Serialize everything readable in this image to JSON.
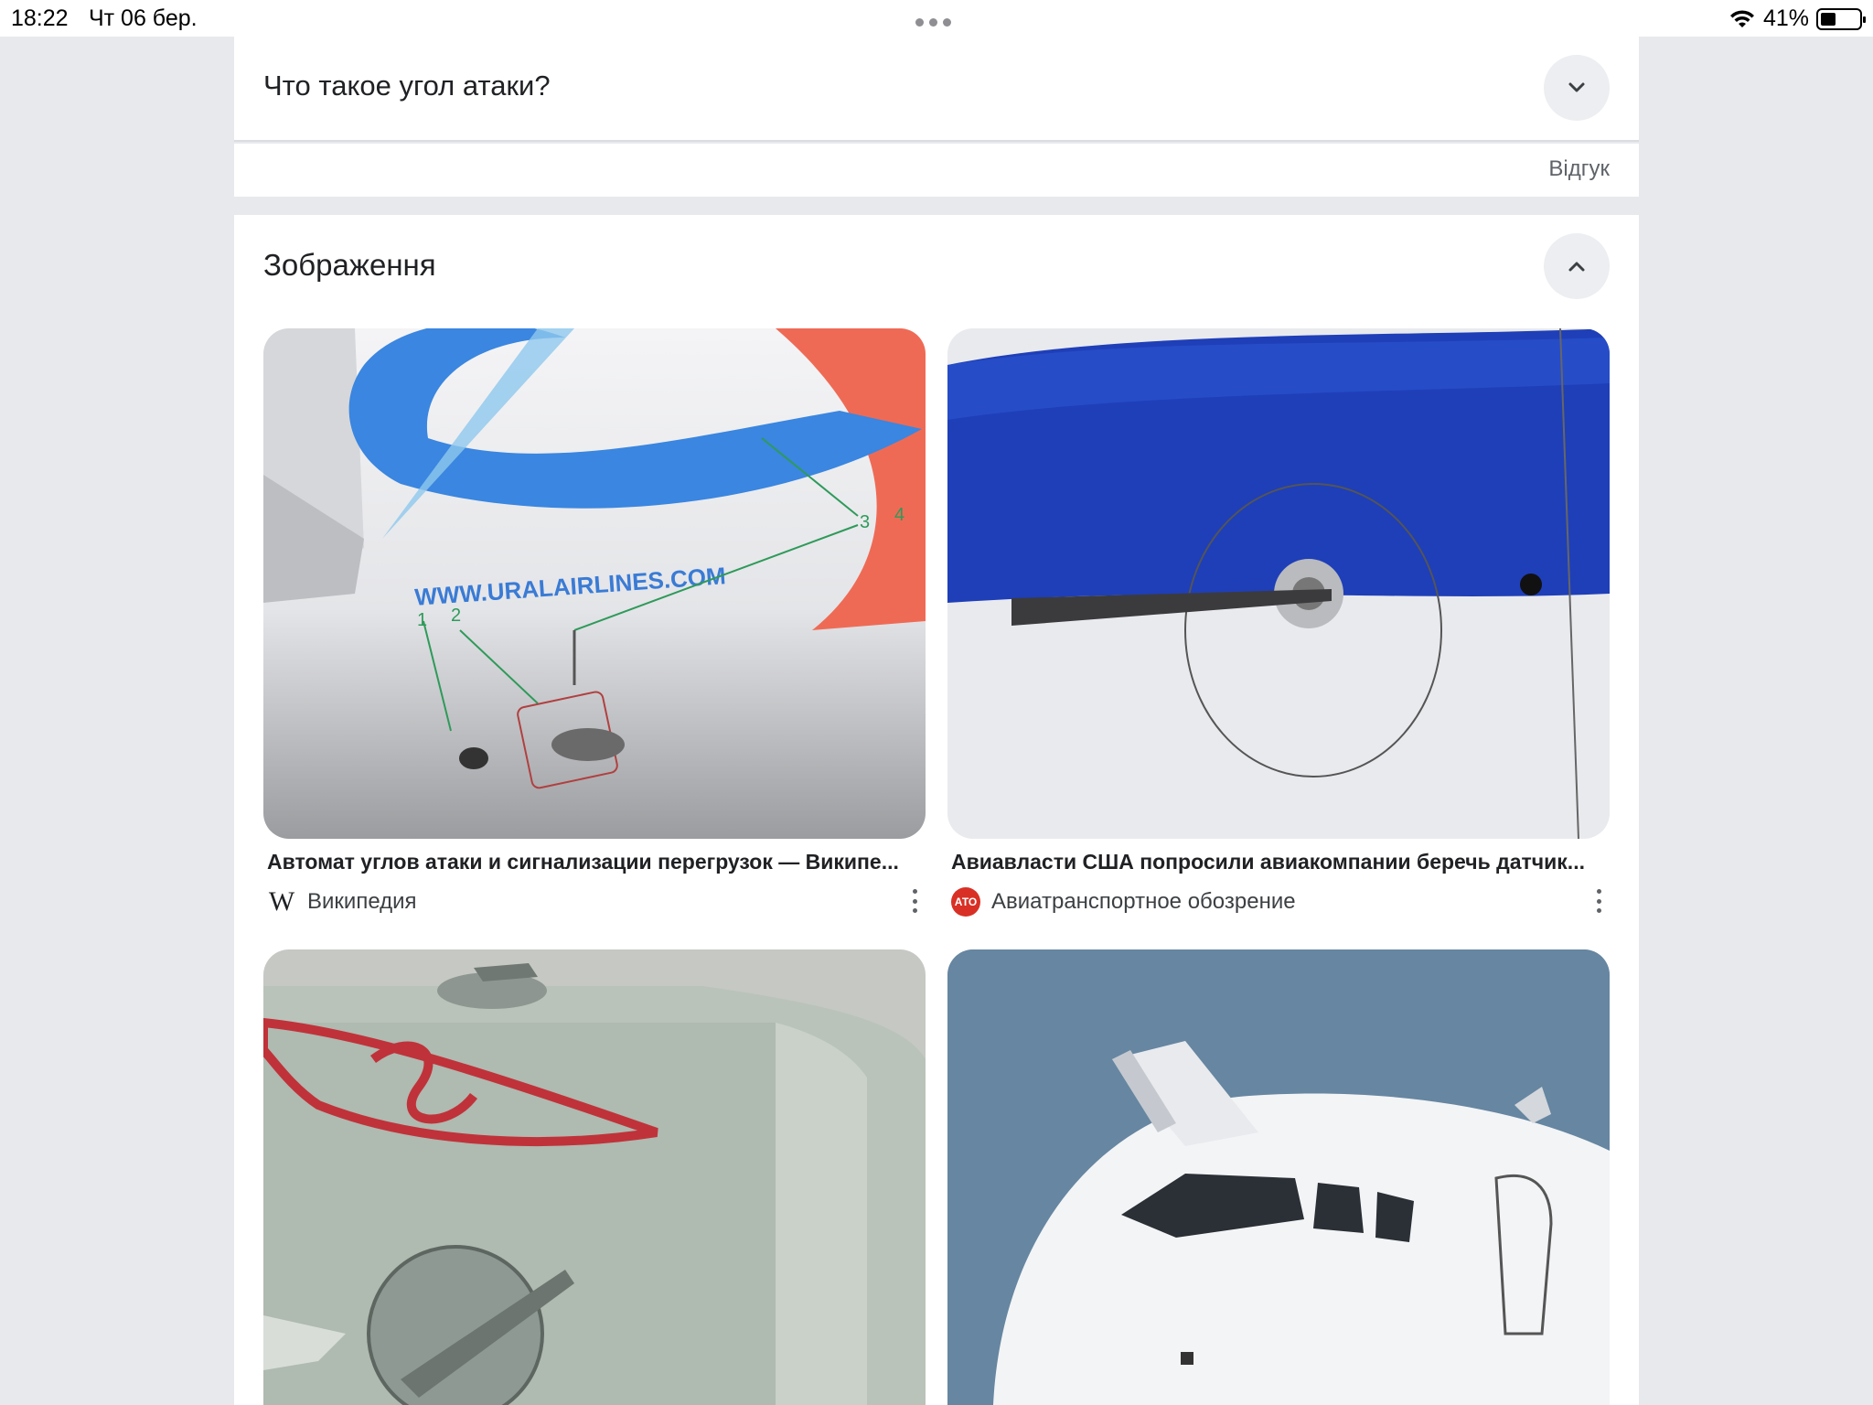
{
  "status_bar": {
    "time": "18:22",
    "date": "Чт 06 бер.",
    "battery": "41%",
    "battery_level": 0.41
  },
  "question_card": {
    "question": "Что такое угол атаки?",
    "expand_icon": "chevron-down-icon"
  },
  "feedback": {
    "label": "Відгук"
  },
  "images_section": {
    "title": "Зображення",
    "collapse_icon": "chevron-up-icon",
    "results": [
      {
        "caption": "Автомат углов атаки и сигнализации перегрузок — Википе...",
        "source": "Википедия",
        "logo": "W",
        "image_text": "WWW.URALAIRLINES.COM"
      },
      {
        "caption": "Авиавласти США попросили авиакомпании беречь датчик...",
        "source": "Авиатранспортное обозрение",
        "logo": "АТО"
      },
      {
        "caption": "",
        "source": ""
      },
      {
        "caption": "",
        "source": ""
      }
    ]
  },
  "colors": {
    "page_bg": "#e8e9ec",
    "card_bg": "#ffffff",
    "button_bg": "#eceef1",
    "text_primary": "#202124",
    "text_secondary": "#5f6368"
  }
}
